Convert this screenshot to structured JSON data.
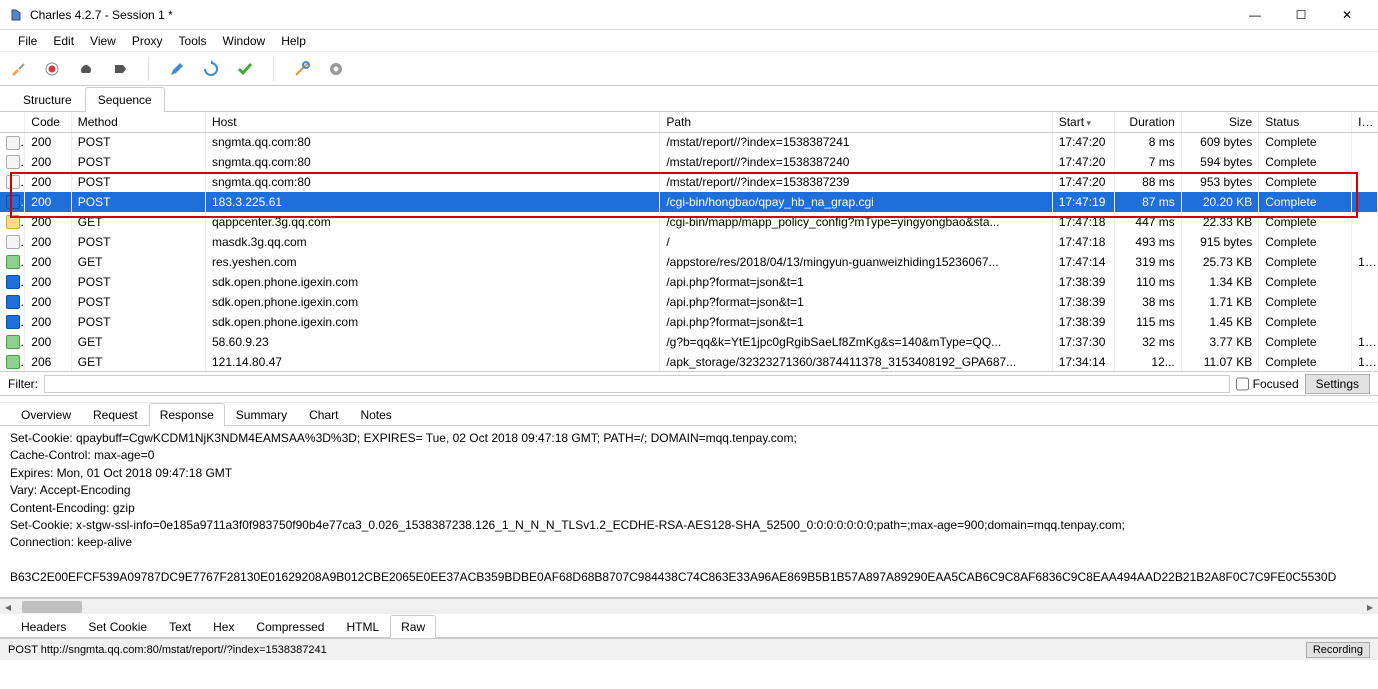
{
  "window": {
    "title": "Charles 4.2.7 - Session 1 *"
  },
  "menu": {
    "items": [
      "File",
      "Edit",
      "View",
      "Proxy",
      "Tools",
      "Window",
      "Help"
    ]
  },
  "view_tabs": {
    "structure": "Structure",
    "sequence": "Sequence",
    "active": "sequence"
  },
  "columns": {
    "code": "Code",
    "method": "Method",
    "host": "Host",
    "path": "Path",
    "start": "Start",
    "duration": "Duration",
    "size": "Size",
    "status": "Status",
    "info": "I..."
  },
  "rows": [
    {
      "icon": "doc",
      "code": "200",
      "method": "POST",
      "host": "sngmta.qq.com:80",
      "path": "/mstat/report//?index=1538387241",
      "start": "17:47:20",
      "duration": "8 ms",
      "size": "609 bytes",
      "status": "Complete",
      "info": ""
    },
    {
      "icon": "doc",
      "code": "200",
      "method": "POST",
      "host": "sngmta.qq.com:80",
      "path": "/mstat/report//?index=1538387240",
      "start": "17:47:20",
      "duration": "7 ms",
      "size": "594 bytes",
      "status": "Complete",
      "info": ""
    },
    {
      "icon": "doc",
      "code": "200",
      "method": "POST",
      "host": "sngmta.qq.com:80",
      "path": "/mstat/report//?index=1538387239",
      "start": "17:47:20",
      "duration": "88 ms",
      "size": "953 bytes",
      "status": "Complete",
      "info": ""
    },
    {
      "icon": "blue",
      "code": "200",
      "method": "POST",
      "host": "183.3.225.61",
      "path": "/cgi-bin/hongbao/qpay_hb_na_grap.cgi",
      "start": "17:47:19",
      "duration": "87 ms",
      "size": "20.20 KB",
      "status": "Complete",
      "info": "",
      "selected": true
    },
    {
      "icon": "js",
      "code": "200",
      "method": "GET",
      "host": "qappcenter.3g.qq.com",
      "path": "/cgi-bin/mapp/mapp_policy_config?mType=yingyongbao&sta...",
      "start": "17:47:18",
      "duration": "447 ms",
      "size": "22.33 KB",
      "status": "Complete",
      "info": ""
    },
    {
      "icon": "doc",
      "code": "200",
      "method": "POST",
      "host": "masdk.3g.qq.com",
      "path": "/",
      "start": "17:47:18",
      "duration": "493 ms",
      "size": "915 bytes",
      "status": "Complete",
      "info": ""
    },
    {
      "icon": "img",
      "code": "200",
      "method": "GET",
      "host": "res.yeshen.com",
      "path": "/appstore/res/2018/04/13/mingyun-guanweizhiding15236067...",
      "start": "17:47:14",
      "duration": "319 ms",
      "size": "25.73 KB",
      "status": "Complete",
      "info": "1..."
    },
    {
      "icon": "blue",
      "code": "200",
      "method": "POST",
      "host": "sdk.open.phone.igexin.com",
      "path": "/api.php?format=json&t=1",
      "start": "17:38:39",
      "duration": "110 ms",
      "size": "1.34 KB",
      "status": "Complete",
      "info": ""
    },
    {
      "icon": "blue",
      "code": "200",
      "method": "POST",
      "host": "sdk.open.phone.igexin.com",
      "path": "/api.php?format=json&t=1",
      "start": "17:38:39",
      "duration": "38 ms",
      "size": "1.71 KB",
      "status": "Complete",
      "info": ""
    },
    {
      "icon": "blue",
      "code": "200",
      "method": "POST",
      "host": "sdk.open.phone.igexin.com",
      "path": "/api.php?format=json&t=1",
      "start": "17:38:39",
      "duration": "115 ms",
      "size": "1.45 KB",
      "status": "Complete",
      "info": ""
    },
    {
      "icon": "img",
      "code": "200",
      "method": "GET",
      "host": "58.60.9.23",
      "path": "/g?b=qq&k=YtE1jpc0gRgibSaeLf8ZmKg&s=140&mType=QQ...",
      "start": "17:37:30",
      "duration": "32 ms",
      "size": "3.77 KB",
      "status": "Complete",
      "info": "1..."
    },
    {
      "icon": "img",
      "code": "206",
      "method": "GET",
      "host": "121.14.80.47",
      "path": "/apk_storage/32323271360/3874411378_3153408192_GPA687...",
      "start": "17:34:14",
      "duration": "12...",
      "size": "11.07 KB",
      "status": "Complete",
      "info": "1..."
    }
  ],
  "filter": {
    "label": "Filter:",
    "focused_label": "Focused",
    "settings_label": "Settings"
  },
  "detail_tabs": {
    "items": [
      "Overview",
      "Request",
      "Response",
      "Summary",
      "Chart",
      "Notes"
    ],
    "active": "Response"
  },
  "response_lines": [
    "Set-Cookie: qpaybuff=CgwKCDM1NjK3NDM4EAMSAA%3D%3D; EXPIRES= Tue, 02 Oct 2018 09:47:18 GMT; PATH=/; DOMAIN=mqq.tenpay.com;",
    "Cache-Control: max-age=0",
    "Expires: Mon, 01 Oct 2018 09:47:18 GMT",
    "Vary: Accept-Encoding",
    "Content-Encoding: gzip",
    "Set-Cookie: x-stgw-ssl-info=0e185a9711a3f0f983750f90b4e77ca3_0.026_1538387238.126_1_N_N_N_TLSv1.2_ECDHE-RSA-AES128-SHA_52500_0:0:0:0:0:0:0;path=;max-age=900;domain=mqq.tenpay.com;",
    "Connection: keep-alive",
    "",
    "B63C2E00EFCF539A09787DC9E7767F28130E01629208A9B012CBE2065E0EE37ACB359BDBE0AF68D68B8707C984438C74C863E33A96AE869B5B1B57A897A89290EAA5CAB6C9C8AF6836C9C8EAA494AAD22B21B2A8F0C7C9FE0C5530D"
  ],
  "format_tabs": {
    "items": [
      "Headers",
      "Set Cookie",
      "Text",
      "Hex",
      "Compressed",
      "HTML",
      "Raw"
    ],
    "active": "Raw"
  },
  "statusbar": {
    "left": "POST http://sngmta.qq.com:80/mstat/report//?index=1538387241",
    "recording": "Recording"
  }
}
